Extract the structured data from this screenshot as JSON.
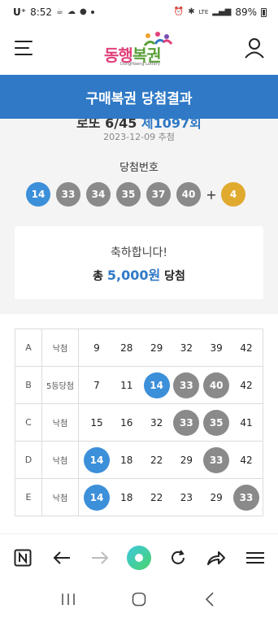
{
  "status_bar": {
    "carrier": "U⁺",
    "time": "8:52",
    "battery": "89%",
    "network": "LTE"
  },
  "header": {
    "logo_text_1": "동행",
    "logo_text_2": "복권",
    "logo_sub": "DongHaeng Lottery"
  },
  "title_bar": {
    "title": "구매복권 당첨결과"
  },
  "draw": {
    "game": "로또 6/45",
    "round": "제1097회",
    "date": "2023-12-09 추첨",
    "winning_label": "당첨번호",
    "winning_numbers": [
      "14",
      "33",
      "34",
      "35",
      "37",
      "40"
    ],
    "bonus_number": "4",
    "plus": "+"
  },
  "prize": {
    "congrats": "축하합니다!",
    "prefix": "총",
    "amount": "5,000원",
    "suffix": "당첨"
  },
  "games": [
    {
      "label": "A",
      "result": "낙첨",
      "numbers": [
        "9",
        "28",
        "29",
        "32",
        "39",
        "42"
      ],
      "match": [
        false,
        false,
        false,
        false,
        false,
        false
      ]
    },
    {
      "label": "B",
      "result": "5등당첨",
      "numbers": [
        "7",
        "11",
        "14",
        "33",
        "40",
        "42"
      ],
      "match": [
        false,
        false,
        "blue",
        "gray",
        "gray",
        false
      ]
    },
    {
      "label": "C",
      "result": "낙첨",
      "numbers": [
        "15",
        "16",
        "32",
        "33",
        "35",
        "41"
      ],
      "match": [
        false,
        false,
        false,
        "gray",
        "gray",
        false
      ]
    },
    {
      "label": "D",
      "result": "낙첨",
      "numbers": [
        "14",
        "18",
        "22",
        "29",
        "33",
        "42"
      ],
      "match": [
        "blue",
        false,
        false,
        false,
        "gray",
        false
      ]
    },
    {
      "label": "E",
      "result": "낙첨",
      "numbers": [
        "14",
        "18",
        "22",
        "23",
        "29",
        "33"
      ],
      "match": [
        "blue",
        false,
        false,
        false,
        false,
        "gray"
      ]
    }
  ],
  "colors": {
    "brand_blue": "#2f79c6",
    "ball_blue": "#3c8fd9",
    "ball_gray": "#8a8a8a",
    "ball_yellow": "#e0aa2e"
  },
  "browser_toolbar": {
    "icons": [
      "naver-icon",
      "back-arrow-icon",
      "forward-arrow-icon",
      "home-circle-icon",
      "reload-icon",
      "share-icon",
      "menu-icon"
    ]
  },
  "android_nav": {
    "icons": [
      "recent-apps-icon",
      "home-icon",
      "back-icon"
    ]
  }
}
